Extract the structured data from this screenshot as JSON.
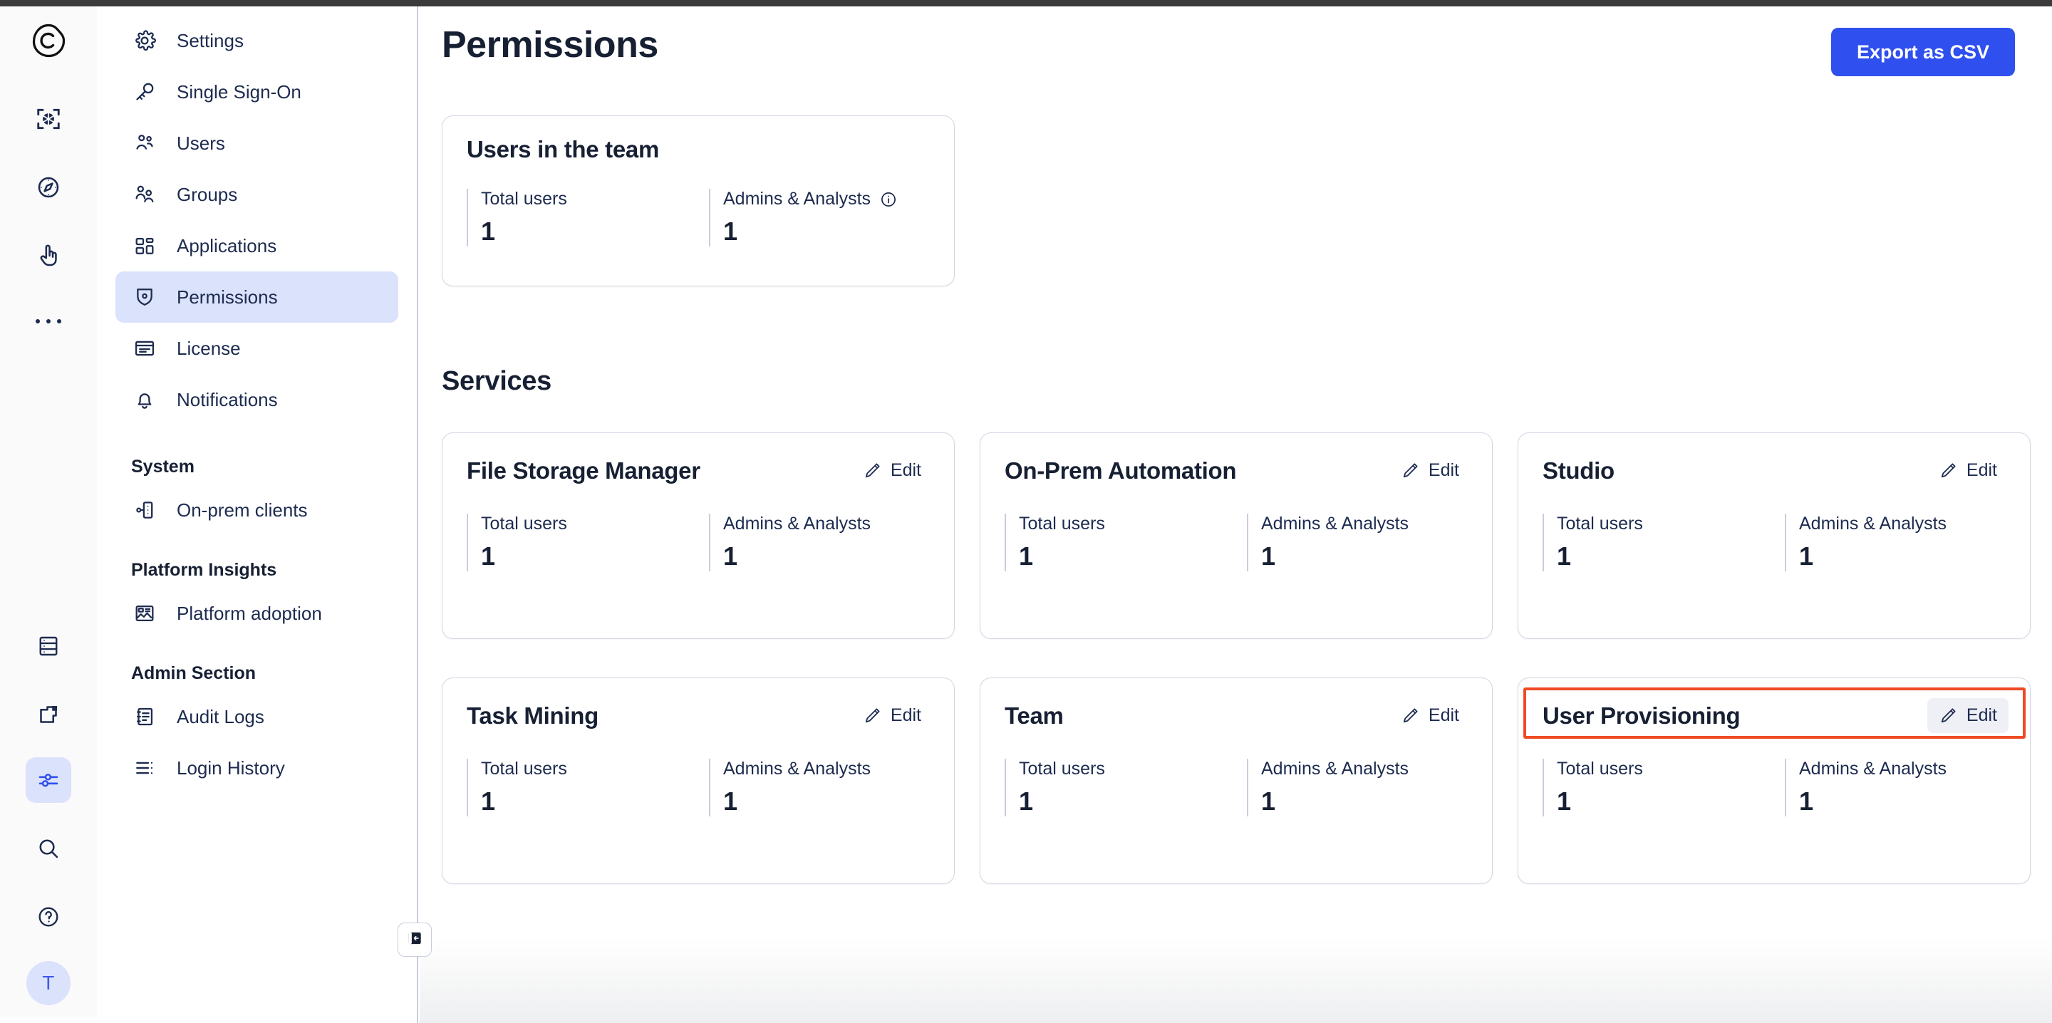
{
  "rail": {
    "logo": "celonis-logo-icon",
    "items": [
      {
        "name": "capture-icon",
        "selected": false
      },
      {
        "name": "compass-icon",
        "selected": false
      },
      {
        "name": "hand-pointer-icon",
        "selected": false
      },
      {
        "name": "more-ellipsis-icon",
        "selected": false
      },
      {
        "name": "data-server-icon",
        "selected": false
      },
      {
        "name": "apps-icon",
        "selected": false
      },
      {
        "name": "admin-sliders-icon",
        "selected": true
      },
      {
        "name": "search-icon",
        "selected": false
      },
      {
        "name": "help-icon",
        "selected": false
      }
    ],
    "avatar_initial": "T"
  },
  "sidebar": {
    "items": [
      {
        "label": "Settings",
        "icon": "gear-icon",
        "active": false
      },
      {
        "label": "Single Sign-On",
        "icon": "key-icon",
        "active": false
      },
      {
        "label": "Users",
        "icon": "users-icon",
        "active": false
      },
      {
        "label": "Groups",
        "icon": "groups-icon",
        "active": false
      },
      {
        "label": "Applications",
        "icon": "applications-icon",
        "active": false
      },
      {
        "label": "Permissions",
        "icon": "shield-icon",
        "active": true
      },
      {
        "label": "License",
        "icon": "license-card-icon",
        "active": false
      },
      {
        "label": "Notifications",
        "icon": "bell-icon",
        "active": false
      }
    ],
    "sections": [
      {
        "title": "System",
        "items": [
          {
            "label": "On-prem clients",
            "icon": "on-prem-client-icon",
            "active": false
          }
        ]
      },
      {
        "title": "Platform Insights",
        "items": [
          {
            "label": "Platform adoption",
            "icon": "chart-image-icon",
            "active": false
          }
        ]
      },
      {
        "title": "Admin Section",
        "items": [
          {
            "label": "Audit Logs",
            "icon": "audit-log-icon",
            "active": false
          },
          {
            "label": "Login History",
            "icon": "login-history-icon",
            "active": false
          }
        ]
      }
    ],
    "collapse_icon": "collapse-panel-icon"
  },
  "header": {
    "title": "Permissions",
    "export_label": "Export as CSV"
  },
  "overview_card": {
    "title": "Users in the team",
    "stats": [
      {
        "label": "Total users",
        "value": "1",
        "info": false
      },
      {
        "label": "Admins & Analysts",
        "value": "1",
        "info": true
      }
    ]
  },
  "services": {
    "heading": "Services",
    "edit_label": "Edit",
    "stat_labels": {
      "total": "Total users",
      "admins": "Admins & Analysts"
    },
    "cards": [
      {
        "title": "File Storage Manager",
        "total_users": "1",
        "admins_analysts": "1",
        "highlighted": false,
        "edit_hovered": false
      },
      {
        "title": "On-Prem Automation",
        "total_users": "1",
        "admins_analysts": "1",
        "highlighted": false,
        "edit_hovered": false
      },
      {
        "title": "Studio",
        "total_users": "1",
        "admins_analysts": "1",
        "highlighted": false,
        "edit_hovered": false
      },
      {
        "title": "Task Mining",
        "total_users": "1",
        "admins_analysts": "1",
        "highlighted": false,
        "edit_hovered": false
      },
      {
        "title": "Team",
        "total_users": "1",
        "admins_analysts": "1",
        "highlighted": false,
        "edit_hovered": false
      },
      {
        "title": "User Provisioning",
        "total_users": "1",
        "admins_analysts": "1",
        "highlighted": true,
        "edit_hovered": true
      }
    ]
  },
  "colors": {
    "accent_blue": "#2f4fee",
    "nav_active_bg": "#dbe2fb",
    "text_dark": "#172033",
    "annotation": "#f04a25",
    "card_border": "#d4d7e3"
  }
}
